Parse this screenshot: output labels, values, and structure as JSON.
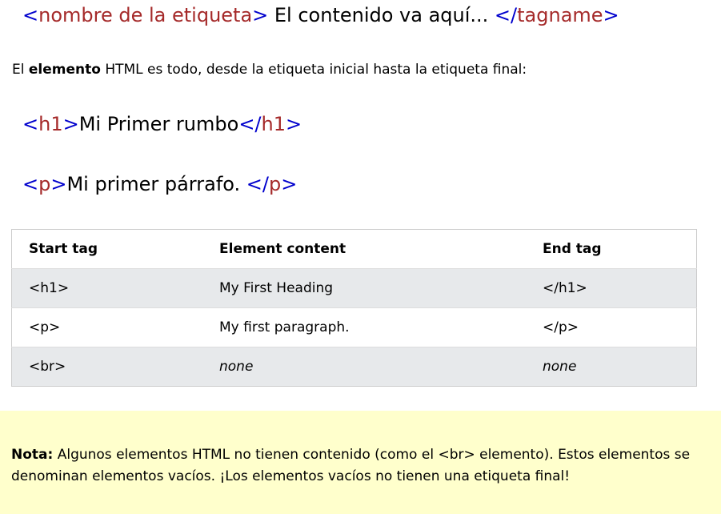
{
  "syntax_line": {
    "open_lt": "<",
    "open_name": "nombre de la etiqueta",
    "open_gt": ">",
    "content": " El contenido va aquí... ",
    "close_lt": "</",
    "close_name": "tagname",
    "close_gt": ">"
  },
  "intro": {
    "prefix": "El ",
    "bold": "elemento",
    "suffix": " HTML es todo, desde la etiqueta inicial hasta la etiqueta final:"
  },
  "example_h1": {
    "open_lt": "<",
    "open_name": "h1",
    "open_gt": ">",
    "content": "Mi Primer rumbo",
    "close_lt": "</",
    "close_name": "h1",
    "close_gt": ">"
  },
  "example_p": {
    "open_lt": "<",
    "open_name": "p",
    "open_gt": ">",
    "content": "Mi primer párrafo. ",
    "close_lt": "</",
    "close_name": "p",
    "close_gt": ">"
  },
  "table": {
    "headers": [
      "Start tag",
      "Element content",
      "End tag"
    ],
    "rows": [
      [
        "<h1>",
        "My First Heading",
        "</h1>"
      ],
      [
        "<p>",
        "My first paragraph.",
        "</p>"
      ],
      [
        "<br>",
        "none",
        "none"
      ]
    ]
  },
  "note": {
    "bold": "Nota:",
    "text": " Algunos elementos HTML no tienen contenido (como el <br> elemento). Estos elementos se denominan elementos vacíos. ¡Los elementos vacíos no tienen una etiqueta final!"
  },
  "colors": {
    "bracket": "#0000cd",
    "tag_name": "#a52a2a",
    "note_background": "#ffffcc",
    "table_row_shade": "#e7e9eb"
  }
}
